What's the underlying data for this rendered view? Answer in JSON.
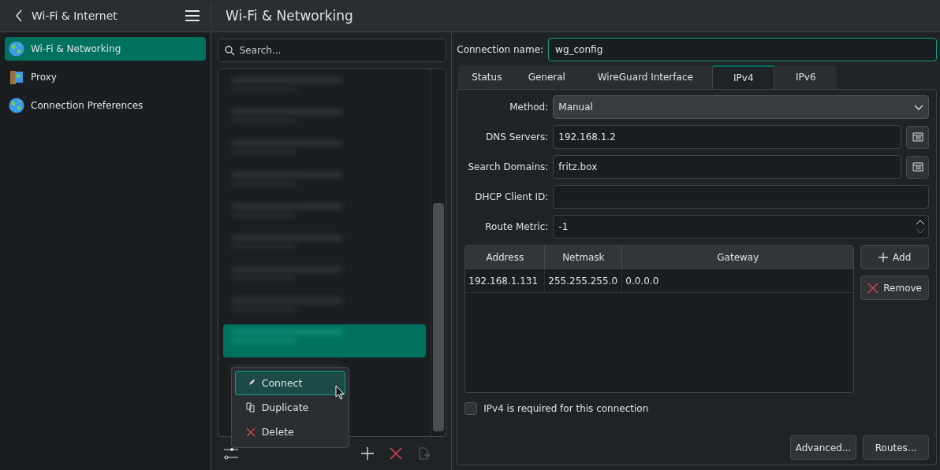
{
  "header": {
    "back_title": "Wi-Fi & Internet",
    "page_title": "Wi-Fi & Networking"
  },
  "sidebar": {
    "items": [
      {
        "label": "Wi-Fi & Networking",
        "selected": true,
        "kind": "globe"
      },
      {
        "label": "Proxy",
        "selected": false,
        "kind": "proxy"
      },
      {
        "label": "Connection Preferences",
        "selected": false,
        "kind": "globe"
      }
    ]
  },
  "search": {
    "placeholder": "Search..."
  },
  "connections": [
    {
      "selected": false
    },
    {
      "selected": false
    },
    {
      "selected": false
    },
    {
      "selected": false
    },
    {
      "selected": false
    },
    {
      "selected": false
    },
    {
      "selected": false
    },
    {
      "selected": false
    },
    {
      "selected": true
    },
    {
      "selected": false
    }
  ],
  "context_menu": [
    {
      "label": "Connect",
      "selected": true,
      "kind": "connect"
    },
    {
      "label": "Duplicate",
      "selected": false,
      "kind": "duplicate"
    },
    {
      "label": "Delete",
      "selected": false,
      "kind": "delete"
    }
  ],
  "connection_name": {
    "label": "Connection name:",
    "value": "wg_config"
  },
  "tabs": [
    {
      "label": "Status",
      "selected": false
    },
    {
      "label": "General",
      "selected": false
    },
    {
      "label": "WireGuard Interface",
      "selected": false
    },
    {
      "label": "IPv4",
      "selected": true
    },
    {
      "label": "IPv6",
      "selected": false
    }
  ],
  "form": [
    {
      "kind": "select",
      "label": "Method:",
      "value": "Manual"
    },
    {
      "kind": "list",
      "label": "DNS Servers:",
      "value": "192.168.1.2"
    },
    {
      "kind": "list",
      "label": "Search Domains:",
      "value": "fritz.box"
    },
    {
      "kind": "text",
      "label": "DHCP Client ID:"
    },
    {
      "kind": "spin",
      "label": "Route Metric:",
      "value": "-1"
    }
  ],
  "table": {
    "columns": [
      "Address",
      "Netmask",
      "Gateway"
    ],
    "rows": [
      [
        "192.168.1.131",
        "255.255.255.0",
        "0.0.0.0"
      ]
    ]
  },
  "side_buttons": [
    {
      "label": "Add",
      "kind": "add"
    },
    {
      "label": "Remove",
      "kind": "remove"
    }
  ],
  "required_checkbox": {
    "label": "IPv4 is required for this connection",
    "checked": false
  },
  "bottom_buttons": [
    "Advanced...",
    "Routes..."
  ]
}
